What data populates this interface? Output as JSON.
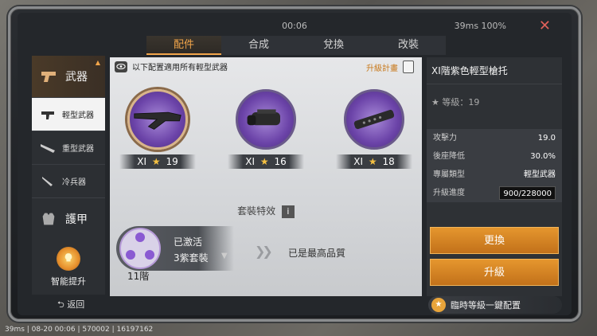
{
  "status": {
    "time": "00:06",
    "network": "39ms 100%"
  },
  "tabs": [
    "配件",
    "合成",
    "兌換",
    "改裝"
  ],
  "sidebar": {
    "weapons": "武器",
    "light": "輕型武器",
    "heavy": "重型武器",
    "melee": "冷兵器",
    "armor": "護甲",
    "smart": "智能提升",
    "back": "返回"
  },
  "main": {
    "note": "以下配置適用所有輕型武器",
    "plan": "升級計畫",
    "parts": [
      {
        "tier": "XI",
        "level": "19",
        "icon": "stock-icon"
      },
      {
        "tier": "XI",
        "level": "16",
        "icon": "scope-mount-icon"
      },
      {
        "tier": "XI",
        "level": "18",
        "icon": "barrel-icon"
      }
    ],
    "set_title": "套裝特效",
    "set_status": "已激活",
    "set_name": "3紫套裝",
    "set_level": "11階",
    "best": "已是最高品質"
  },
  "detail": {
    "title": "XI階紫色輕型槍托",
    "grade_label": "等級：19",
    "stats": [
      {
        "label": "攻擊力",
        "value": "19.0"
      },
      {
        "label": "後座降低",
        "value": "30.0%"
      },
      {
        "label": "專屬類型",
        "value": "輕型武器"
      }
    ],
    "progress_label": "升級進度",
    "progress_value": "900/228000",
    "progress_fraction": 0.0039,
    "replace": "更換",
    "upgrade": "升級",
    "quick": "臨時等級一鍵配置"
  },
  "footer": "39ms | 08-20 00:06 | 570002 | 16197162",
  "colors": {
    "accent": "#f2a54a",
    "button": "#d5842a",
    "purple": "#6b43a8"
  }
}
